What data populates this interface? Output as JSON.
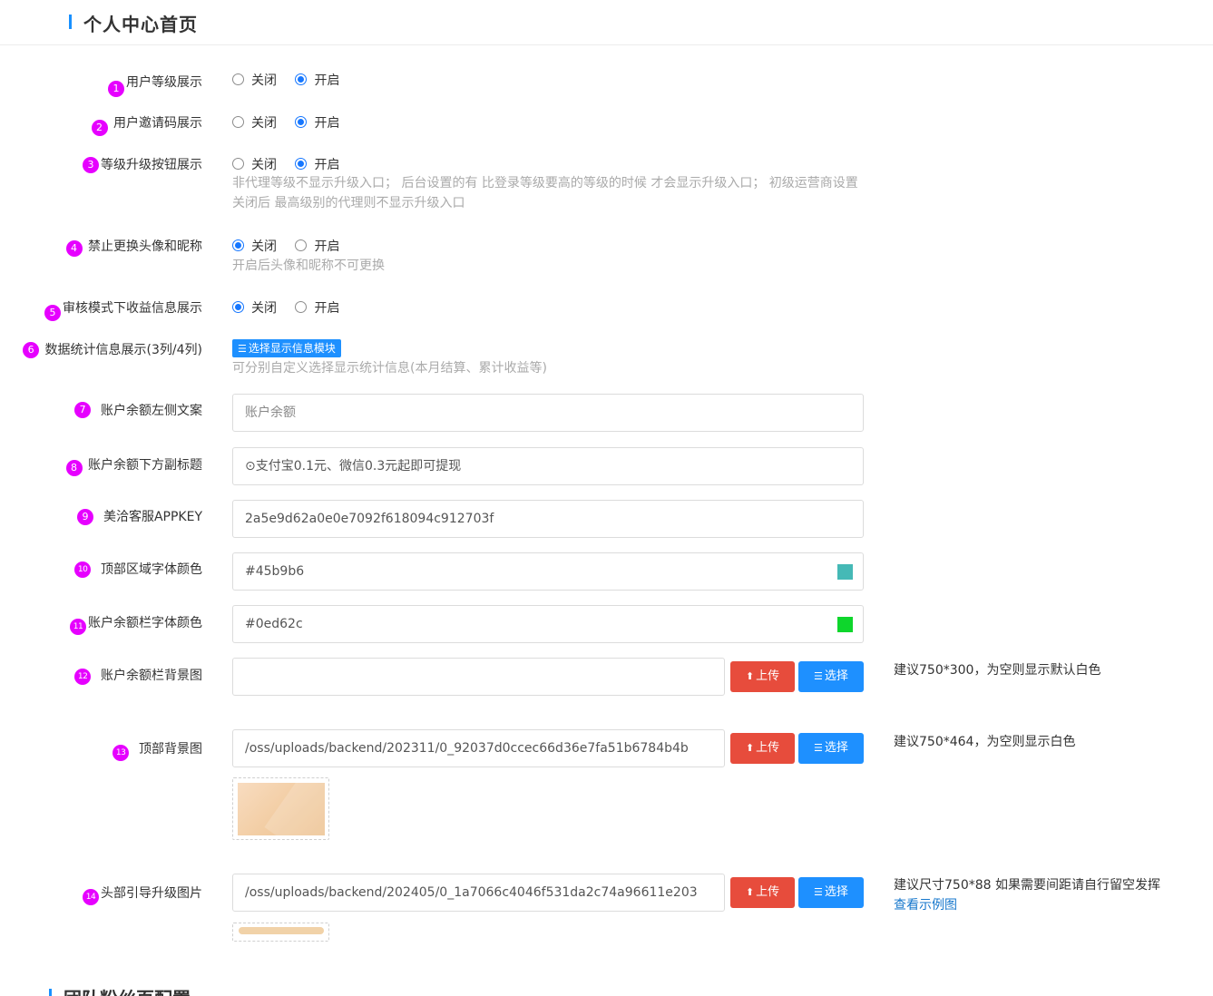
{
  "header": {
    "title": "个人中心首页"
  },
  "fields": {
    "level_display": {
      "badge": "1",
      "label": "用户等级展示",
      "options": [
        "关闭",
        "开启"
      ],
      "selected": 1
    },
    "invite_code_display": {
      "badge": "2",
      "label": "用户邀请码展示",
      "options": [
        "关闭",
        "开启"
      ],
      "selected": 1
    },
    "upgrade_button_display": {
      "badge": "3",
      "label": "等级升级按钮展示",
      "options": [
        "关闭",
        "开启"
      ],
      "selected": 1,
      "help": "非代理等级不显示升级入口； 后台设置的有 比登录等级要高的等级的时候 才会显示升级入口； 初级运营商设置关闭后 最高级别的代理则不显示升级入口"
    },
    "forbid_avatar_change": {
      "badge": "4",
      "label": "禁止更换头像和昵称",
      "options": [
        "关闭",
        "开启"
      ],
      "selected": 0,
      "help": "开启后头像和昵称不可更换"
    },
    "review_mode_income": {
      "badge": "5",
      "label": "审核模式下收益信息展示",
      "options": [
        "关闭",
        "开启"
      ],
      "selected": 0
    },
    "stats_display": {
      "badge": "6",
      "label": "数据统计信息展示(3列/4列)",
      "button": "选择显示信息模块",
      "help": "可分别自定义选择显示统计信息(本月结算、累计收益等)"
    },
    "balance_left_text": {
      "badge": "7",
      "label": "账户余额左侧文案",
      "placeholder": "账户余额"
    },
    "balance_subtitle": {
      "badge": "8",
      "label": "账户余额下方副标题",
      "value": "⊙支付宝0.1元、微信0.3元起即可提现"
    },
    "meiqia_appkey": {
      "badge": "9",
      "label": "美洽客服APPKEY",
      "value": "2a5e9d62a0e0e7092f618094c912703f"
    },
    "top_font_color": {
      "badge": "10",
      "label": "顶部区域字体颜色",
      "value": "#45b9b6",
      "color": "#45b9b6"
    },
    "balance_font_color": {
      "badge": "11",
      "label": "账户余额栏字体颜色",
      "value": "#0ed62c",
      "color": "#0ed62c"
    },
    "balance_bg_image": {
      "badge": "12",
      "label": "账户余额栏背景图",
      "value": "",
      "upload": "上传",
      "select": "选择",
      "tip": "建议750*300，为空则显示默认白色"
    },
    "top_bg_image": {
      "badge": "13",
      "label": "顶部背景图",
      "value": "/oss/uploads/backend/202311/0_92037d0ccec66d36e7fa51b6784b4b",
      "upload": "上传",
      "select": "选择",
      "tip": "建议750*464，为空则显示白色"
    },
    "header_upgrade_image": {
      "badge": "14",
      "label": "头部引导升级图片",
      "value": "/oss/uploads/backend/202405/0_1a7066c4046f531da2c74a96611e203",
      "upload": "上传",
      "select": "选择",
      "tip": "建议尺寸750*88 如果需要间距请自行留空发挥",
      "link": "查看示例图"
    }
  },
  "section2": {
    "title": "团队粉丝页配置"
  },
  "icons": {
    "upload": "upload-icon",
    "list": "list-icon"
  }
}
